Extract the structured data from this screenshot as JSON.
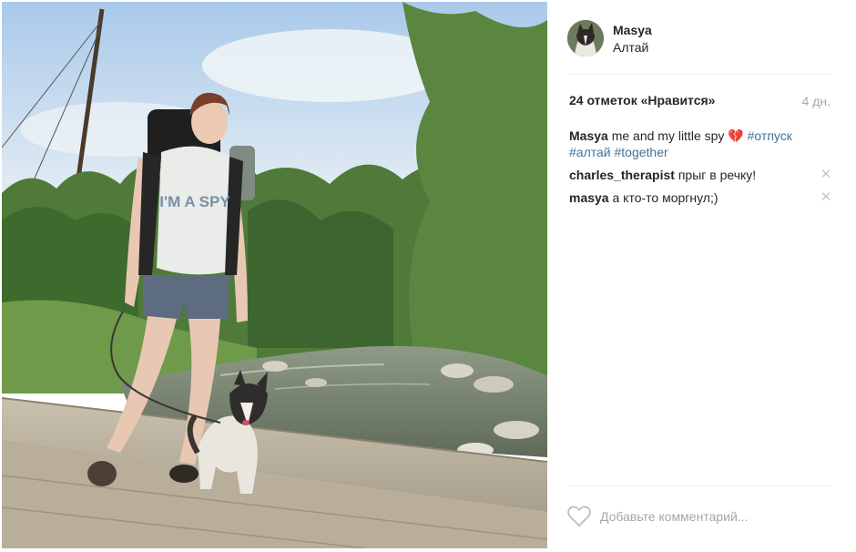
{
  "post": {
    "username": "Masya",
    "location": "Алтай",
    "likes": "24 отметок «Нравится»",
    "time_ago": "4 дн.",
    "caption": {
      "author": "Masya",
      "text": "me and my little spy",
      "emoji": "💔",
      "hashtags": [
        "#отпуск",
        "#алтай",
        "#together"
      ]
    },
    "comments": [
      {
        "author": "charles_therapist",
        "text": "прыг в речку!"
      },
      {
        "author": "masya",
        "text": "а кто-то моргнул;)"
      }
    ],
    "comment_placeholder": "Добавьте комментарий...",
    "photo_text": "I'M A SPY"
  },
  "colors": {
    "text": "#262626",
    "hashtag": "#3f729b",
    "muted": "#a5a7aa",
    "divider": "#efefef"
  },
  "icons": {
    "remove": "close-icon",
    "like": "heart-outline-icon"
  }
}
